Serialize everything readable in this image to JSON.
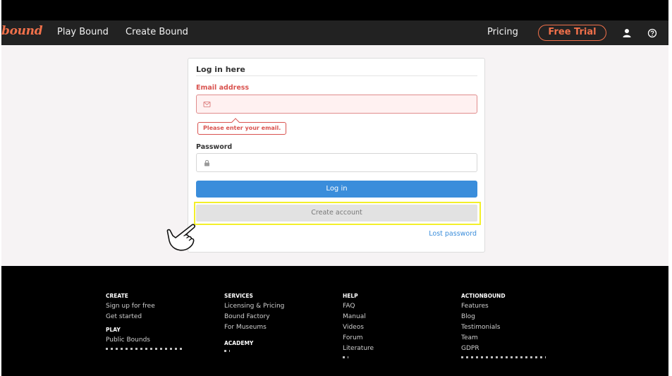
{
  "navbar": {
    "logo": "bound",
    "links": [
      "Play Bound",
      "Create Bound"
    ],
    "pricing": "Pricing",
    "trial": "Free Trial"
  },
  "login": {
    "title": "Log in here",
    "email_label": "Email address",
    "email_error": "Please enter your email.",
    "password_label": "Password",
    "login_button": "Log in",
    "create_button": "Create account",
    "lost_password": "Lost password"
  },
  "footer": {
    "create": {
      "heading": "CREATE",
      "items": [
        "Sign up for free",
        "Get started"
      ]
    },
    "play": {
      "heading": "PLAY",
      "items": [
        "Public Bounds"
      ]
    },
    "services": {
      "heading": "SERVICES",
      "items": [
        "Licensing & Pricing",
        "Bound Factory",
        "For Museums"
      ]
    },
    "academy": {
      "heading": "ACADEMY"
    },
    "help": {
      "heading": "HELP",
      "items": [
        "FAQ",
        "Manual",
        "Videos",
        "Forum",
        "Literature"
      ]
    },
    "actionbound": {
      "heading": "ACTIONBOUND",
      "items": [
        "Features",
        "Blog",
        "Testimonials",
        "Team",
        "GDPR"
      ]
    }
  },
  "colors": {
    "brand": "#f0704a",
    "primary": "#3a8ddb",
    "error": "#d9534f",
    "highlight": "#f3ef2a"
  },
  "icons": [
    "user-icon",
    "help-icon",
    "mail-icon",
    "lock-icon",
    "pointing-hand-icon"
  ]
}
